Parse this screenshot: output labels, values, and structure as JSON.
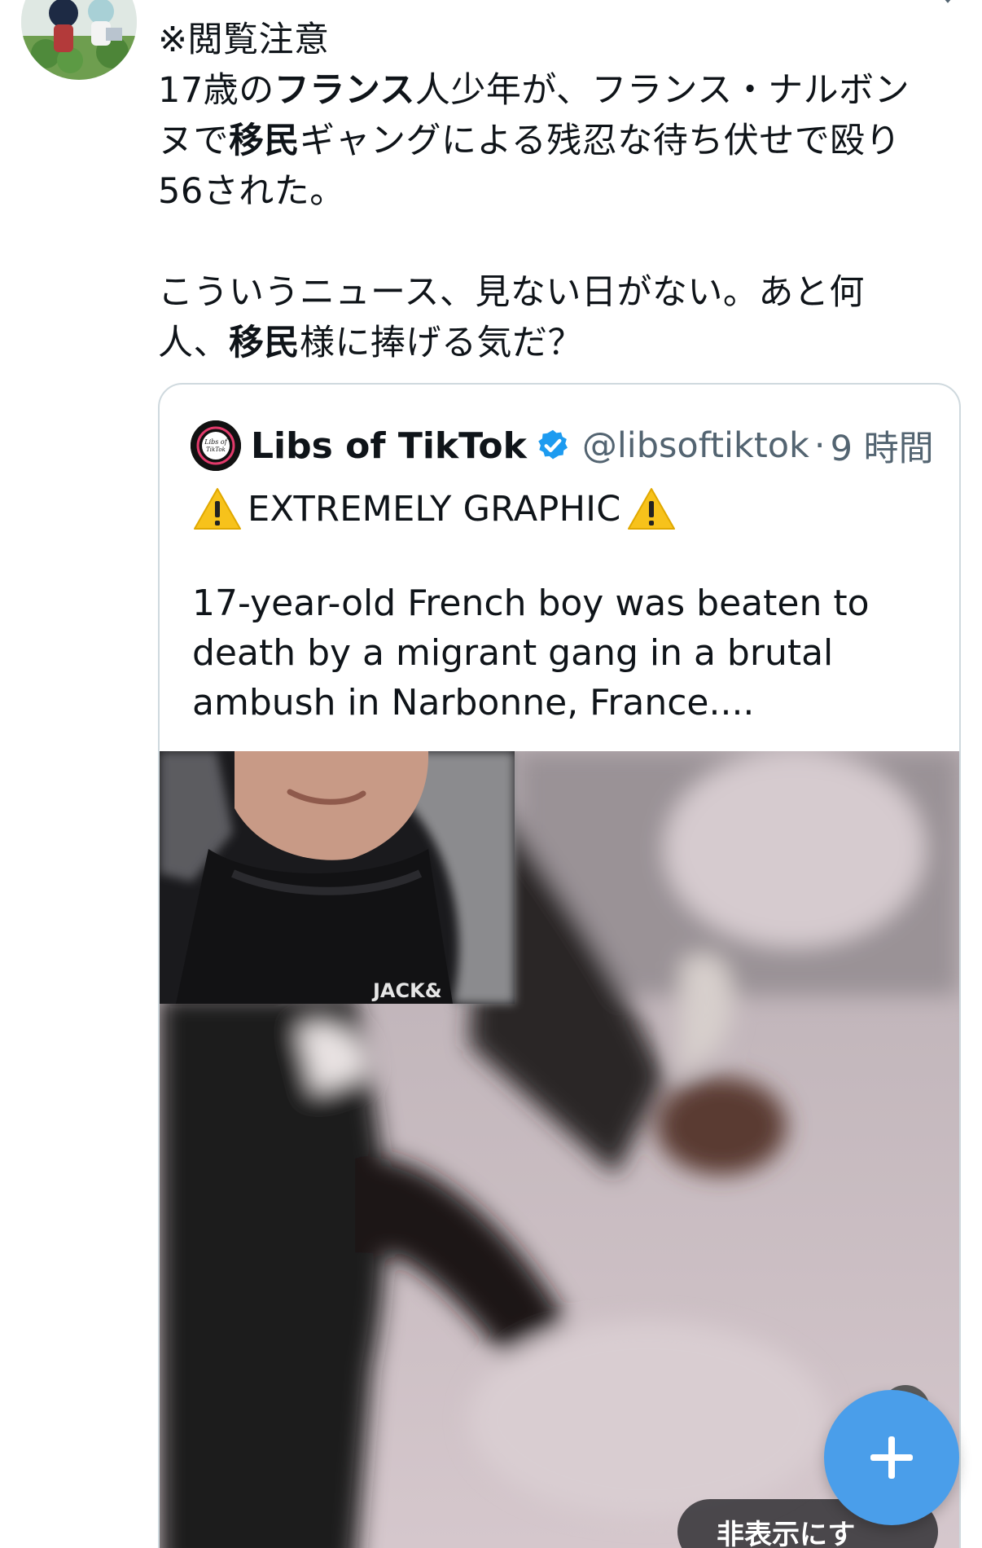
{
  "tweet": {
    "line1": "※閲覧注意",
    "line2_pre": "17歳の",
    "line2_bold": "フランス",
    "line2_post": "人少年が、フランス・ナルボン",
    "line3_pre": "ヌで",
    "line3_bold": "移民",
    "line3_post": "ギャングによる残忍な待ち伏せで殴り",
    "line4": "56された。",
    "line5": "こういうニュース、見ない日がない。あと何",
    "line6_pre": "人、",
    "line6_bold": "移民",
    "line6_post": "様に捧げる気だ？"
  },
  "quote": {
    "avatar_text_1": "Libs of",
    "avatar_text_2": "TikTok",
    "name": "Libs of TikTok",
    "handle": "@libsoftiktok",
    "dot": "·",
    "time": "9 時間",
    "warning": "EXTREMELY GRAPHIC",
    "body_line1": "17-year-old French boy was beaten to",
    "body_line2": "death by a migrant gang in a brutal",
    "body_line3": "ambush in Narbonne, France....",
    "media_jacket_text": "JACK&",
    "hide_label": "非表示にす"
  },
  "colors": {
    "accent": "#4a9eea",
    "verified": "#1d9bf0",
    "text": "#0f1419",
    "secondary": "#536471",
    "border": "#cfd9de",
    "warning": "#f7c21b"
  },
  "icons": {
    "verified": "verified-badge-icon",
    "warning": "warning-icon",
    "compose": "plus-icon",
    "more": "chevron-down-icon"
  }
}
